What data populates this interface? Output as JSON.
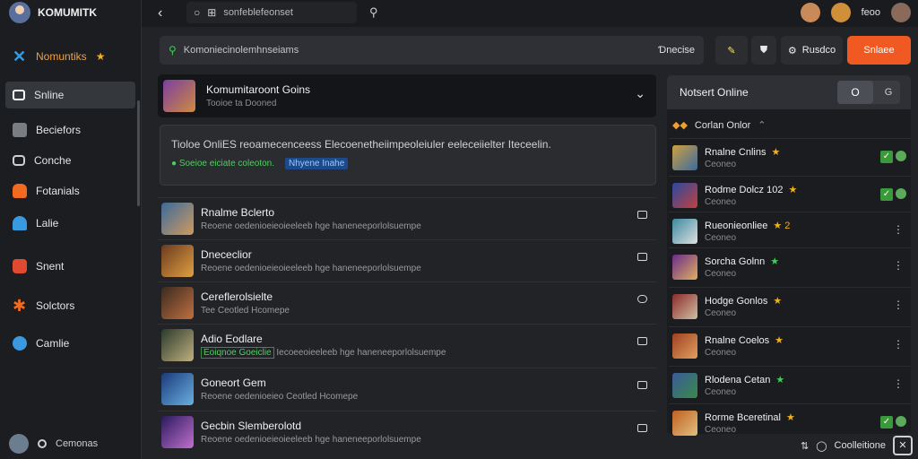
{
  "app": {
    "name": "KOMUMITK"
  },
  "sidebar": {
    "brand_label": "Nomuntiks",
    "items": [
      {
        "label": "Snline",
        "icon": "monitor-icon",
        "color": "#ffffff"
      },
      {
        "label": "Beciefors",
        "icon": "users-icon",
        "color": "#cfcfcf"
      },
      {
        "label": "Conche",
        "icon": "chat-icon",
        "color": "#cfcfcf"
      },
      {
        "label": "Fotanials",
        "icon": "gamepad-icon",
        "color": "#f06a20"
      },
      {
        "label": "Lalie",
        "icon": "people-icon",
        "color": "#3a9ae0"
      },
      {
        "label": "Snent",
        "icon": "record-icon",
        "color": "#e04a30"
      },
      {
        "label": "Solctors",
        "icon": "puzzle-icon",
        "color": "#f06a20"
      },
      {
        "label": "Camlie",
        "icon": "controller-icon",
        "color": "#3a9ae0"
      }
    ],
    "footer_label": "Cemonas"
  },
  "topbar": {
    "search_text": "sonfeblefeonset",
    "user_label": "feoo"
  },
  "main": {
    "search_placeholder": "Komoniecinolemhnseiams",
    "search_right": "Ɗnecise",
    "btn_settings": "Rusdco",
    "btn_primary": "Snlaee",
    "group": {
      "title": "Komumitaroont Goins",
      "subtitle": "Tooioe ta Dooned"
    },
    "info": {
      "description": "Tioloe OnliES reoamecenceess Elecoenetheiimpeoleiuler eeleceiielter Iteceelin.",
      "status": "Soeioe eiciate coleoton.",
      "tag": "Nhyene Inahe"
    },
    "list": [
      {
        "name": "Rnalme Bclerto",
        "sub": "Reoene oedenioeieoieeleeb hge haneneeporlolsuempe",
        "highlight": ""
      },
      {
        "name": "Dnececlior",
        "sub": "Reoene oedenioeieoieeleeb hge haneneeporlolsuempe",
        "highlight": ""
      },
      {
        "name": "Cereflerolsielte",
        "sub": "Tee                   Ceotled Hcomepe",
        "highlight": ""
      },
      {
        "name": "Adio Eodlare",
        "sub": "Iecoeeoieeleeb hge haneneeporlolsuempe",
        "highlight": "Eoiqnoe Goeiclie"
      },
      {
        "name": "Goneort Gem",
        "sub": "Reoene oedenioeieo   Ceotled Hcomepe",
        "highlight": ""
      },
      {
        "name": "Gecbin Slemberolotd",
        "sub": "Reoene oedenioeieoieeleeb hge haneneeporlolsuempe",
        "highlight": ""
      }
    ]
  },
  "right": {
    "title": "Notsert Online",
    "toggle_on": "O",
    "toggle_off": "G",
    "subheader": "Corlan Onlor",
    "items": [
      {
        "name": "Rnalne Cnlins",
        "sub": "Ceoneo",
        "star": "★",
        "star_color": "gold",
        "badge": "✓",
        "action": "check"
      },
      {
        "name": "Rodme Dolcz 102",
        "sub": "Ceoneo",
        "star": "★",
        "star_color": "gold",
        "badge": "✓",
        "action": "check"
      },
      {
        "name": "Rueonieonliee",
        "sub": "Ceoneo",
        "star": "★ 2",
        "star_color": "gold",
        "badge": "",
        "action": "more"
      },
      {
        "name": "Sorcha Golnn",
        "sub": "Ceoneo",
        "star": "★",
        "star_color": "green",
        "badge": "",
        "action": "more"
      },
      {
        "name": "Hodge Gonlos",
        "sub": "Ceoneo",
        "star": "★",
        "star_color": "gold",
        "badge": "",
        "action": "more"
      },
      {
        "name": "Rnalne Coelos",
        "sub": "Ceoneo",
        "star": "★",
        "star_color": "gold",
        "badge": "",
        "action": "more"
      },
      {
        "name": "Rlodena Cetan",
        "sub": "Ceoneo",
        "star": "★",
        "star_color": "green",
        "badge": "",
        "action": "more"
      },
      {
        "name": "Rorme Bceretinal",
        "sub": "Ceoneo",
        "star": "★",
        "star_color": "gold",
        "badge": "✓",
        "action": "check"
      }
    ]
  },
  "bottom_label": "Coolleitione"
}
